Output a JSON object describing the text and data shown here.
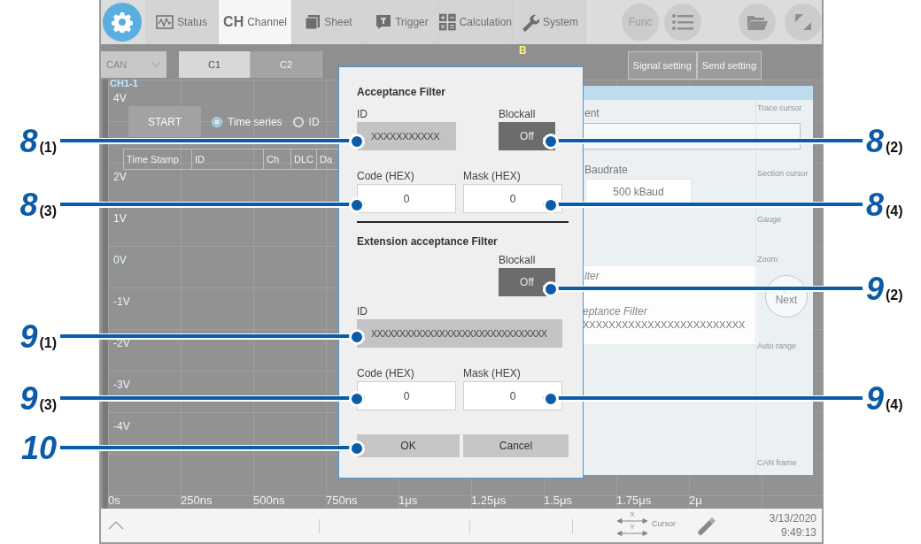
{
  "toolbar": {
    "tabs": [
      {
        "kind": "status",
        "label": "Status",
        "selected": false
      },
      {
        "kind": "channel",
        "icon_text": "CH",
        "label": "Channel",
        "selected": true
      },
      {
        "kind": "sheet",
        "label": "Sheet",
        "selected": false
      },
      {
        "kind": "trigger",
        "label": "Trigger",
        "selected": false
      },
      {
        "kind": "calculation",
        "label": "Calculation",
        "selected": false
      },
      {
        "kind": "system",
        "label": "System",
        "selected": false
      }
    ],
    "buttons": [
      {
        "kind": "func",
        "label": "Func"
      },
      {
        "kind": "list"
      },
      {
        "kind": "folder"
      },
      {
        "kind": "expand"
      }
    ]
  },
  "channel_bar": {
    "module": "CAN",
    "channels": [
      {
        "label": "C1",
        "selected": true
      },
      {
        "label": "C2",
        "selected": false
      }
    ],
    "marker": "B",
    "buttons": [
      "Signal setting",
      "Send setting"
    ]
  },
  "waveform": {
    "channel": "CH1-1",
    "top_label": "4V",
    "y_labels": [
      "2V",
      "1V",
      "0V",
      "-1V",
      "-2V",
      "-3V",
      "-4V"
    ],
    "x_labels": [
      "0s",
      "250ns",
      "500ns",
      "750ns",
      "1μs",
      "1.25μs",
      "1.5μs",
      "1.75μs",
      "2μ"
    ]
  },
  "frame_panel": {
    "start": "START",
    "view_options": [
      {
        "label": "Time series",
        "selected": true
      },
      {
        "label": "ID",
        "selected": false
      }
    ],
    "columns": [
      "Time Stamp",
      "ID",
      "Ch",
      "DLC",
      "Da"
    ]
  },
  "side_panel": {
    "setting_label": "ent",
    "baudrate_label": "Baudrate",
    "baudrate": "500 kBaud",
    "filter_label": "lter",
    "ext_filter_label": "eptance Filter",
    "ext_id": "XXXXXXXXXXXXXXXXXXXXXXXXX",
    "next": "Next",
    "menu": [
      "Trace cursor",
      "Section cursor",
      "Gauge",
      "Zoom",
      "Auto range",
      "CAN frame"
    ]
  },
  "dialog": {
    "sections": [
      {
        "kind": "standard",
        "title": "Acceptance Filter",
        "id_label": "ID",
        "id": "XXXXXXXXXXX",
        "blockall_label": "Blockall",
        "blockall": "Off",
        "code_label": "Code (HEX)",
        "code": "0",
        "mask_label": "Mask (HEX)",
        "mask": "0"
      },
      {
        "kind": "extension",
        "title": "Extension acceptance Filter",
        "id_label": "ID",
        "id": "XXXXXXXXXXXXXXXXXXXXXXXXXXXXXXX",
        "blockall_label": "Blockall",
        "blockall": "Off",
        "code_label": "Code (HEX)",
        "code": "0",
        "mask_label": "Mask (HEX)",
        "mask": "0"
      }
    ],
    "buttons": [
      "OK",
      "Cancel"
    ]
  },
  "status_bar": {
    "axis_x": "X",
    "axis_y": "Y",
    "cursor_label": "Cursor",
    "date": "3/13/2020",
    "time": "9:49:13"
  },
  "callouts": [
    {
      "kind": "left",
      "number": "8",
      "part": "(1)"
    },
    {
      "kind": "right",
      "number": "8",
      "part": "(2)"
    },
    {
      "kind": "left",
      "number": "8",
      "part": "(3)"
    },
    {
      "kind": "right",
      "number": "8",
      "part": "(4)"
    },
    {
      "kind": "right",
      "number": "9",
      "part": "(2)"
    },
    {
      "kind": "left",
      "number": "9",
      "part": "(1)"
    },
    {
      "kind": "left",
      "number": "9",
      "part": "(3)"
    },
    {
      "kind": "right",
      "number": "9",
      "part": "(4)"
    },
    {
      "kind": "left",
      "number": "10"
    }
  ]
}
